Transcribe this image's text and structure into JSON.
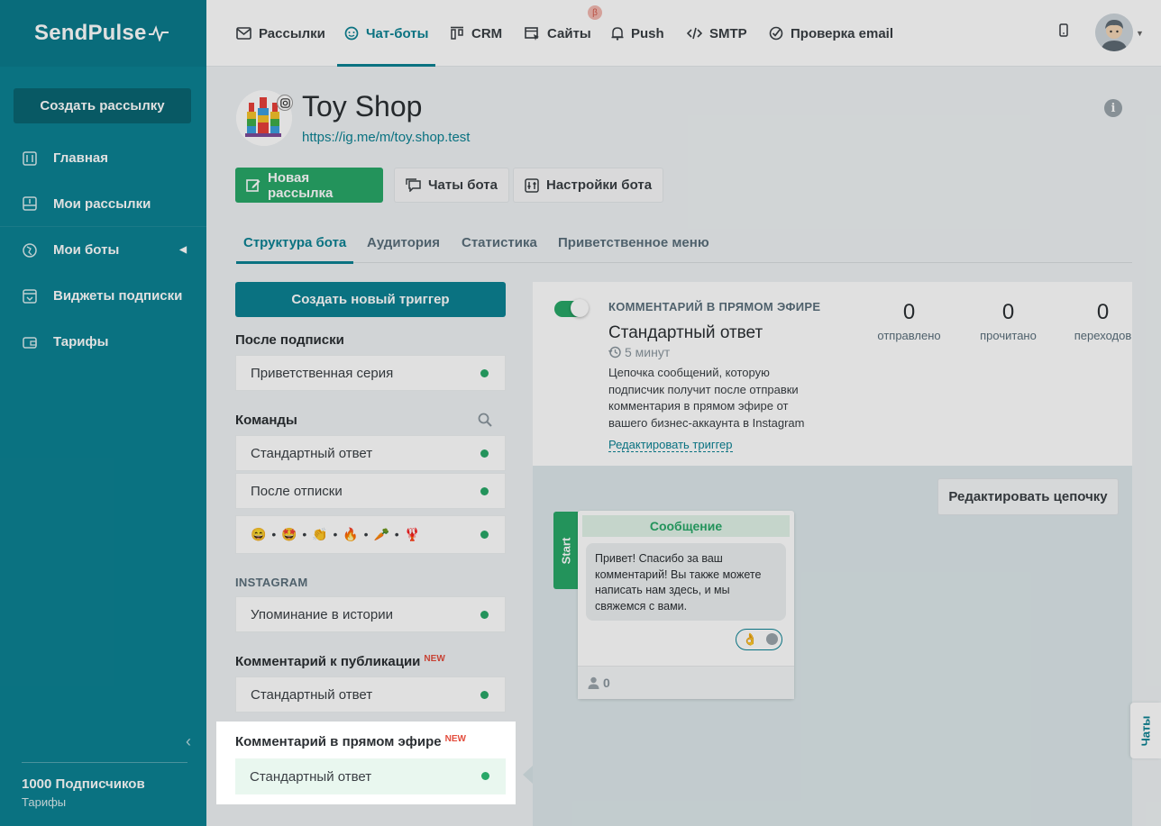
{
  "sidebar": {
    "logo": "SendPulse",
    "create_button": "Создать рассылку",
    "items": [
      {
        "label": "Главная",
        "icon": "sliders-icon"
      },
      {
        "label": "Мои рассылки",
        "icon": "inbox-icon"
      },
      {
        "label": "Мои боты",
        "icon": "globe-icon"
      },
      {
        "label": "Виджеты подписки",
        "icon": "widget-icon"
      },
      {
        "label": "Тарифы",
        "icon": "wallet-icon"
      }
    ],
    "subscribers": "1000 Подписчиков",
    "plan_link": "Тарифы"
  },
  "topnav": {
    "items": [
      {
        "label": "Рассылки",
        "icon": "mail-icon"
      },
      {
        "label": "Чат-боты",
        "icon": "chat-icon"
      },
      {
        "label": "CRM",
        "icon": "kanban-icon"
      },
      {
        "label": "Сайты",
        "icon": "site-icon"
      },
      {
        "label": "Push",
        "icon": "bell-icon"
      },
      {
        "label": "SMTP",
        "icon": "code-icon"
      },
      {
        "label": "Проверка email",
        "icon": "check-icon"
      }
    ],
    "beta_badge": "β"
  },
  "bot": {
    "title": "Toy Shop",
    "link": "https://ig.me/m/toy.shop.test"
  },
  "actions": {
    "new_campaign": "Новая рассылка",
    "bot_chats": "Чаты бота",
    "bot_settings": "Настройки бота"
  },
  "tabs": [
    "Структура бота",
    "Аудитория",
    "Статистика",
    "Приветственное меню"
  ],
  "triggers": {
    "create_button": "Создать новый триггер",
    "after_subscribe": {
      "title": "После подписки",
      "items": [
        "Приветственная серия"
      ]
    },
    "commands": {
      "title": "Команды",
      "items": [
        "Стандартный ответ",
        "После отписки",
        "😄 • 🤩 • 👏 • 🔥 • 🥕 • 🦞"
      ]
    },
    "instagram": {
      "title": "INSTAGRAM",
      "items": [
        "Упоминание в истории"
      ]
    },
    "post_comment": {
      "title": "Комментарий к публикации",
      "badge": "NEW",
      "items": [
        "Стандартный ответ"
      ]
    },
    "live_comment": {
      "title": "Комментарий в прямом эфире",
      "badge": "NEW",
      "items": [
        "Стандартный ответ"
      ]
    }
  },
  "detail": {
    "kind": "КОММЕНТАРИЙ В ПРЯМОМ ЭФИРЕ",
    "name": "Стандартный ответ",
    "delay": "5 минут",
    "description": "Цепочка сообщений, которую подписчик получит после отправки комментария в прямом эфире от вашего бизнес-аккаунта в Instagram",
    "edit_trigger": "Редактировать триггер",
    "stats": [
      {
        "value": "0",
        "label": "отправлено"
      },
      {
        "value": "0",
        "label": "прочитано"
      },
      {
        "value": "0",
        "label": "переходов"
      }
    ],
    "edit_chain": "Редактировать цепочку",
    "flow": {
      "start": "Start",
      "card_title": "Сообщение",
      "message": "Привет! Спасибо за ваш комментарий! Вы также можете написать нам здесь, и мы свяжемся с вами.",
      "reaction": "👌",
      "count": "0"
    }
  },
  "chats_tab": "Чаты",
  "colors": {
    "brand": "#0c8293",
    "green": "#28a868",
    "badge_red": "#e34c3c"
  }
}
